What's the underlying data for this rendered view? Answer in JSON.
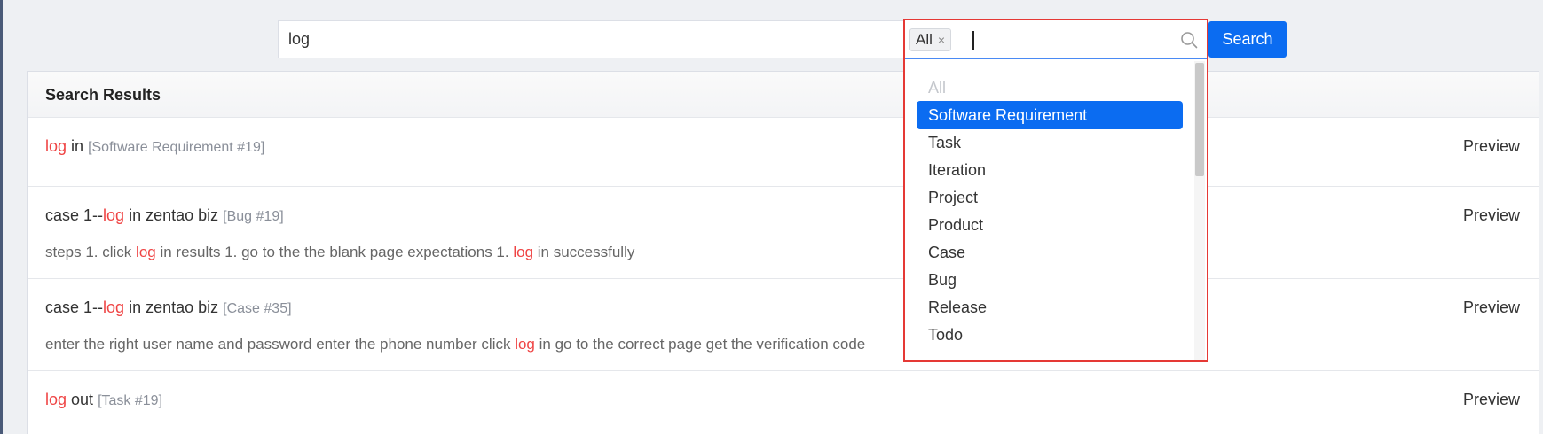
{
  "search": {
    "query": "log",
    "button_label": "Search"
  },
  "type_filter": {
    "selected_tag": "All",
    "tag_remove_glyph": "×",
    "search_icon": "search-icon",
    "options": [
      {
        "label": "All",
        "state": "disabled"
      },
      {
        "label": "Software Requirement",
        "state": "selected"
      },
      {
        "label": "Task",
        "state": "normal"
      },
      {
        "label": "Iteration",
        "state": "normal"
      },
      {
        "label": "Project",
        "state": "normal"
      },
      {
        "label": "Product",
        "state": "normal"
      },
      {
        "label": "Case",
        "state": "normal"
      },
      {
        "label": "Bug",
        "state": "normal"
      },
      {
        "label": "Release",
        "state": "normal"
      },
      {
        "label": "Todo",
        "state": "normal"
      }
    ]
  },
  "results": {
    "header": "Search Results",
    "preview_label": "Preview",
    "items": [
      {
        "title_pre": "",
        "title_hl": "log",
        "title_post": " in",
        "type": "[Software Requirement #19]",
        "desc": null
      },
      {
        "title_pre": "case 1--",
        "title_hl": "log",
        "title_post": " in zentao biz",
        "type": "[Bug #19]",
        "desc": {
          "p1": "steps 1. click ",
          "h1": "log",
          "p2": " in results 1. go to the the blank page expectations 1. ",
          "h2": "log",
          "p3": " in successfully"
        }
      },
      {
        "title_pre": "case 1--",
        "title_hl": "log",
        "title_post": " in zentao biz",
        "type": "[Case #35]",
        "desc": {
          "p1": "enter the right user name and password enter the phone number click ",
          "h1": "log",
          "p2": " in go to the correct page get the verification code",
          "h2": "",
          "p3": ""
        }
      },
      {
        "title_pre": "",
        "title_hl": "log",
        "title_post": " out",
        "type": "[Task #19]",
        "desc": null
      }
    ]
  },
  "colors": {
    "accent": "#0b6cf1",
    "highlight": "#ef4444",
    "focus_outline": "#e53935"
  }
}
